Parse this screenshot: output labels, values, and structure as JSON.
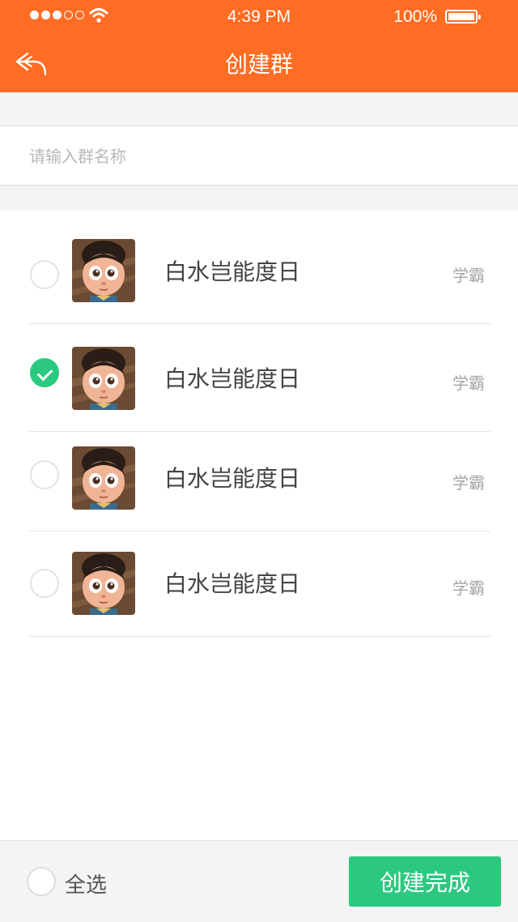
{
  "status_bar": {
    "time": "4:39 PM",
    "battery": "100%"
  },
  "header": {
    "title": "创建群"
  },
  "group_name": {
    "placeholder": "请输入群名称",
    "value": ""
  },
  "members": [
    {
      "name": "白水岂能度日",
      "tag": "学霸",
      "checked": false
    },
    {
      "name": "白水岂能度日",
      "tag": "学霸",
      "checked": true
    },
    {
      "name": "白水岂能度日",
      "tag": "学霸",
      "checked": false
    },
    {
      "name": "白水岂能度日",
      "tag": "学霸",
      "checked": false
    }
  ],
  "footer": {
    "select_all": "全选",
    "create_button": "创建完成"
  },
  "colors": {
    "header": "#ff6c23",
    "accent_green": "#2bc97f"
  }
}
